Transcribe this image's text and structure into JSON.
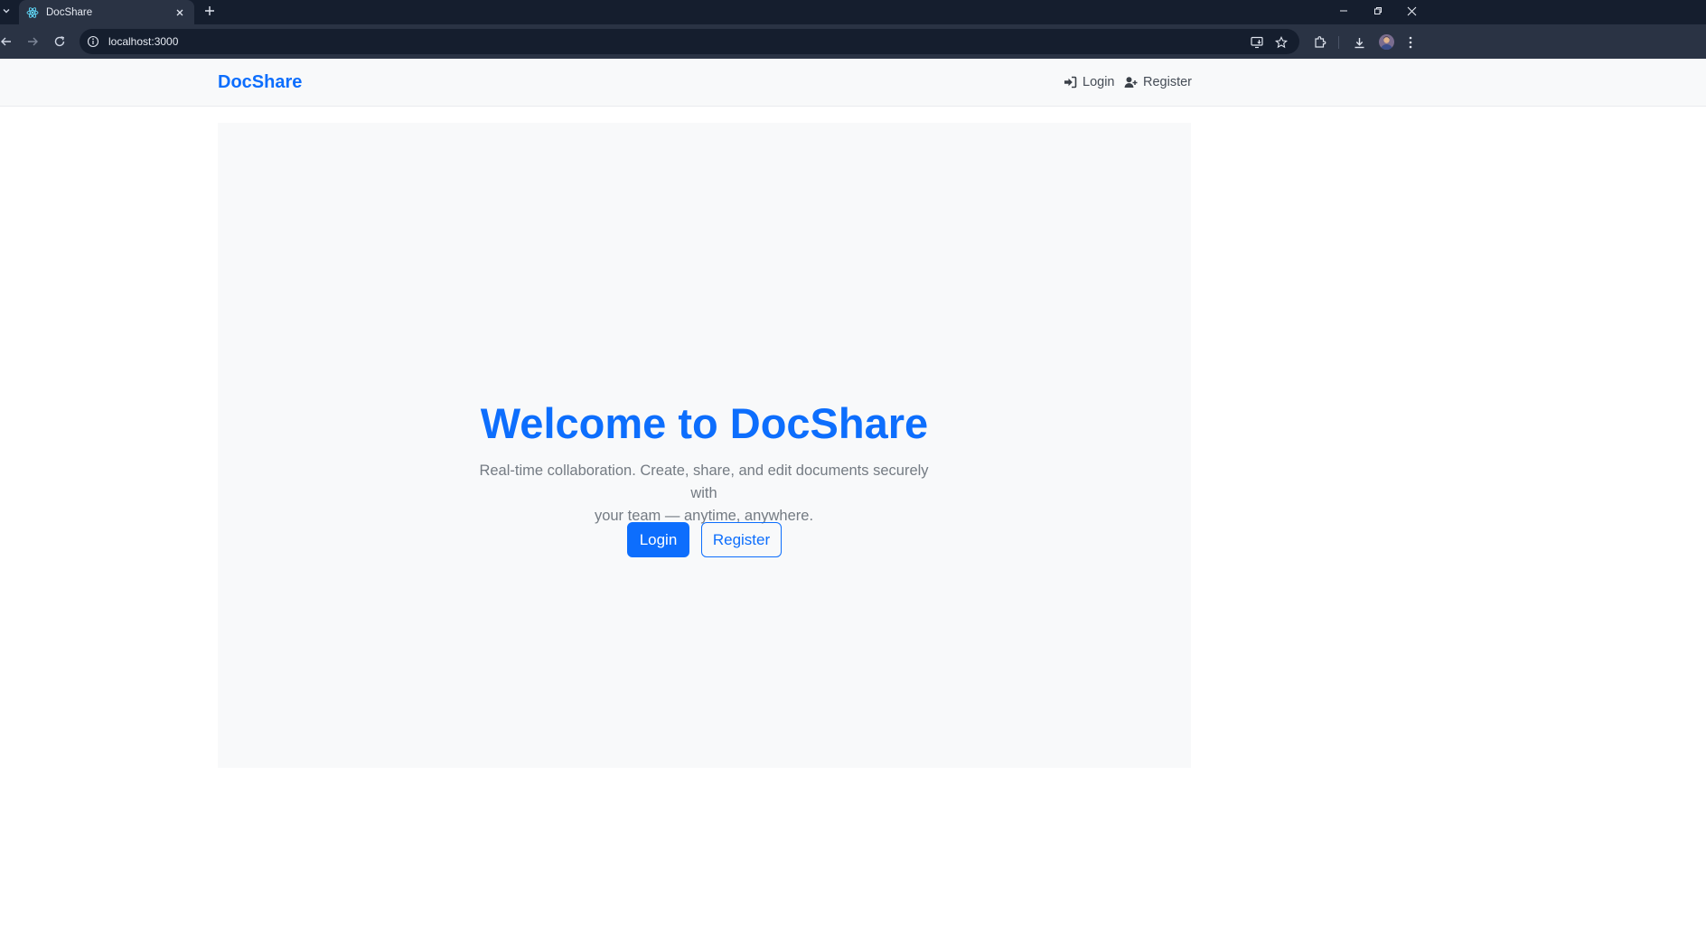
{
  "browser": {
    "tab": {
      "title": "DocShare",
      "favicon": "react-atom-icon"
    },
    "address_bar": {
      "url": "localhost:3000"
    },
    "icons": [
      "tab-list-icon",
      "tab-close-icon",
      "new-tab-icon",
      "minimize-icon",
      "restore-icon",
      "window-close-icon",
      "back-arrow-icon",
      "forward-arrow-icon",
      "reload-icon",
      "site-info-icon",
      "install-app-icon",
      "bookmark-star-icon",
      "extensions-icon",
      "download-icon",
      "profile-avatar",
      "menu-dots-icon"
    ]
  },
  "navbar": {
    "brand": "DocShare",
    "links": {
      "login": "Login",
      "register": "Register"
    }
  },
  "hero": {
    "title": "Welcome to DocShare",
    "subtitle_line1": "Real-time collaboration. Create, share, and edit documents securely with",
    "subtitle_line2": "your team — anytime, anywhere.",
    "buttons": {
      "login": "Login",
      "register": "Register"
    }
  },
  "colors": {
    "primary": "#0d6efd",
    "chrome_dark": "#151e2e",
    "chrome_toolbar": "#2a3344",
    "page_bg": "#f8f9fa",
    "muted_text": "#747b83"
  }
}
